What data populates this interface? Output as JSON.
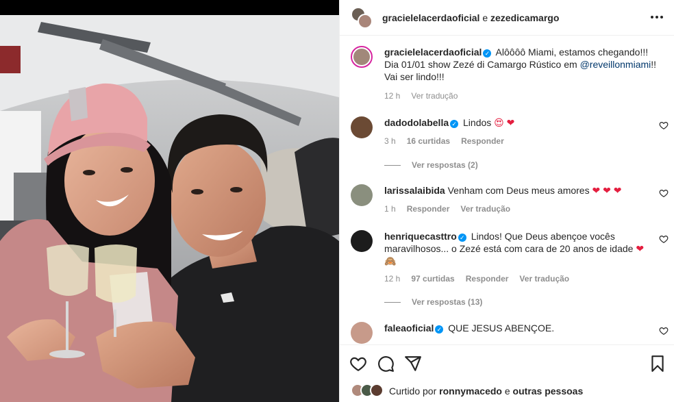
{
  "header": {
    "user1": "gracielelacerdaoficial",
    "conj": "e",
    "user2": "zezedicamargo",
    "more_icon": "more-horizontal-icon"
  },
  "caption": {
    "username": "gracielelacerdaoficial",
    "text_before": "Alôôôô Miami, estamos chegando!!! Dia 01/01 show Zezé di Camargo Rústico em ",
    "mention": "@reveillonmiami",
    "text_after": "!! Vai ser lindo!!!",
    "time": "12 h",
    "translate": "Ver tradução"
  },
  "comments": [
    {
      "username": "dadodolabella",
      "verified": true,
      "text": "Lindos",
      "emoji": "😍 ❤",
      "time": "3 h",
      "likes": "16 curtidas",
      "reply": "Responder",
      "view_replies": "Ver respostas (2)"
    },
    {
      "username": "larissalaibida",
      "verified": false,
      "text": "Venham com Deus meus amores",
      "emoji": "❤ ❤ ❤",
      "time": "1 h",
      "reply": "Responder",
      "translate": "Ver tradução"
    },
    {
      "username": "henriquecasttro",
      "verified": true,
      "text": "Lindos! Que Deus abençoe vocês maravilhosos... o Zezé está com cara de 20 anos de idade",
      "emoji": "❤",
      "emoji2": "🙈",
      "time": "12 h",
      "likes": "97 curtidas",
      "reply": "Responder",
      "translate": "Ver tradução",
      "view_replies": "Ver respostas (13)"
    },
    {
      "username": "faleaoficial",
      "verified": true,
      "text": "QUE JESUS ABENÇOE."
    }
  ],
  "footer": {
    "liked_prefix": "Curtido por",
    "liked_user": "ronnymacedo",
    "liked_conj": "e",
    "liked_others": "outras pessoas"
  },
  "colors": {
    "accent_blue": "#0095f6",
    "heart_red": "#e41e3f",
    "meta_gray": "#8e8e8e",
    "mention": "#00376b"
  }
}
